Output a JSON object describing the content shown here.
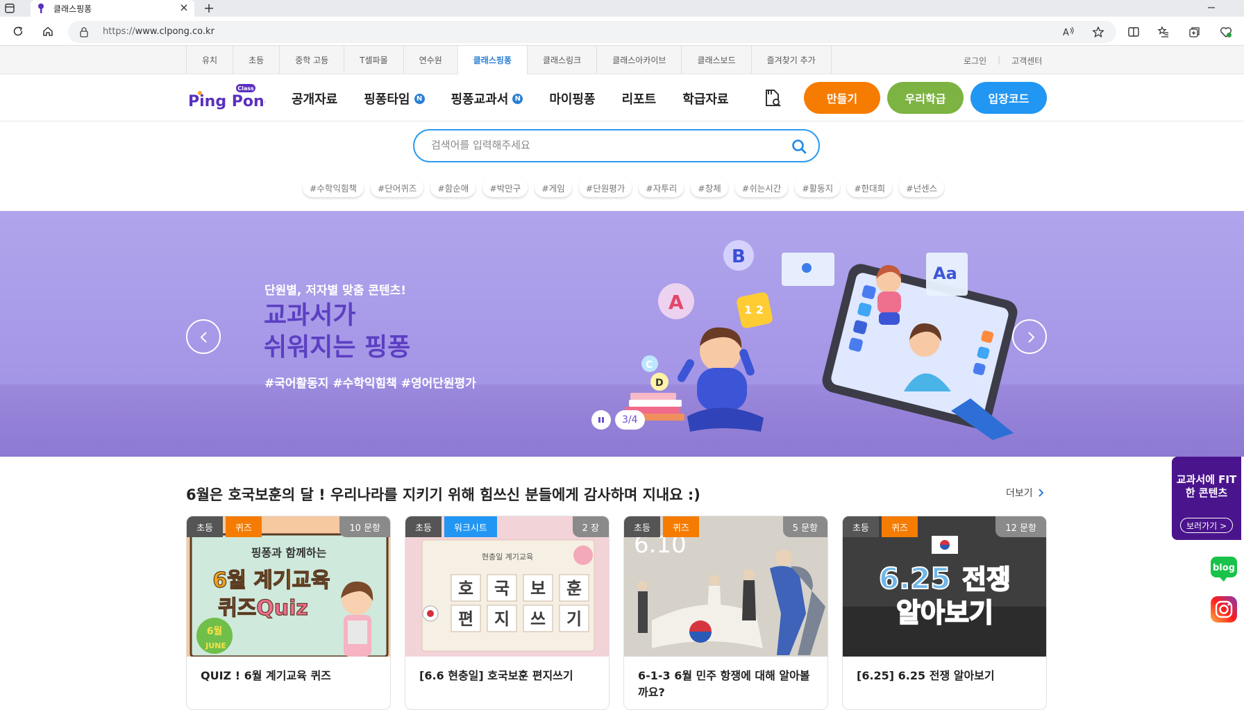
{
  "browser": {
    "tab_title": "클래스핑퐁",
    "url_prefix": "https://",
    "url_host": "www.clpong.co.kr"
  },
  "site_nav": {
    "items": [
      "유치",
      "초등",
      "중학 고등",
      "T셀파몰",
      "연수원",
      "클래스핑퐁",
      "클래스링크",
      "클래스아카이브",
      "클래스보드",
      "즐겨찾기 추가"
    ],
    "active": "클래스핑퐁",
    "login": "로그인",
    "support": "고객센터"
  },
  "header": {
    "logo_text": "Ping Pong",
    "logo_badge": "Class",
    "menu": [
      "공개자료",
      "핑퐁타임",
      "핑퐁교과서",
      "마이핑퐁",
      "리포트",
      "학급자료"
    ],
    "new_badge": "N",
    "buttons": {
      "make": "만들기",
      "myclass": "우리학급",
      "entry": "입장코드"
    },
    "colors": {
      "make": "#f57c00",
      "myclass": "#7cb342",
      "entry": "#2196f3"
    }
  },
  "search": {
    "placeholder": "검색어를 입력해주세요",
    "tags": [
      "#수학익힘책",
      "#단어퀴즈",
      "#함순애",
      "#박만구",
      "#게임",
      "#단원평가",
      "#자투리",
      "#창체",
      "#쉬는시간",
      "#활동지",
      "#한대희",
      "#넌센스"
    ]
  },
  "banner": {
    "subtitle": "단원별, 저자별 맞춤 콘텐츠!",
    "title_line1": "교과서가",
    "title_line2": "쉬워지는 핑퐁",
    "hashtags": "#국어활동지 #수학익힘책 #영어단원평가",
    "pager": "3/4"
  },
  "section": {
    "title": "6월은 호국보훈의 달 ! 우리나라를 지키기 위해 힘쓰신 분들에게 감사하며 지내요 :)",
    "more": "더보기",
    "cards": [
      {
        "level": "초등",
        "type": "퀴즈",
        "type_color": "#f57c00",
        "count": "10 문항",
        "title": "QUIZ ! 6월 계기교육 퀴즈",
        "thumb_top": "핑퐁과 함께하는",
        "thumb_main": "6월 계기교육",
        "thumb_sub": "퀴즈Quiz",
        "thumb_badge": "6월",
        "thumb_badge2": "JUNE"
      },
      {
        "level": "초등",
        "type": "워크시트",
        "type_color": "#2196f3",
        "count": "2 장",
        "title": "[6.6 현충일] 호국보훈 편지쓰기",
        "thumb_top": "현충일 계기교육",
        "thumb_row1": [
          "호",
          "국",
          "보",
          "훈"
        ],
        "thumb_row2": [
          "편",
          "지",
          "쓰",
          "기"
        ]
      },
      {
        "level": "초등",
        "type": "퀴즈",
        "type_color": "#f57c00",
        "count": "5 문항",
        "title": "6-1-3 6월 민주 항쟁에 대해 알아볼까요?",
        "thumb_top": "6.10"
      },
      {
        "level": "초등",
        "type": "퀴즈",
        "type_color": "#f57c00",
        "count": "12 문항",
        "title": "[6.25] 6.25 전쟁 알아보기",
        "thumb_line1a": "6.25",
        "thumb_line1b": "전쟁",
        "thumb_line2": "알아보기"
      }
    ]
  },
  "side": {
    "ad_text": "교과서에 FIT한 콘텐츠",
    "ad_button": "보러가기 >",
    "blog": "blog"
  }
}
